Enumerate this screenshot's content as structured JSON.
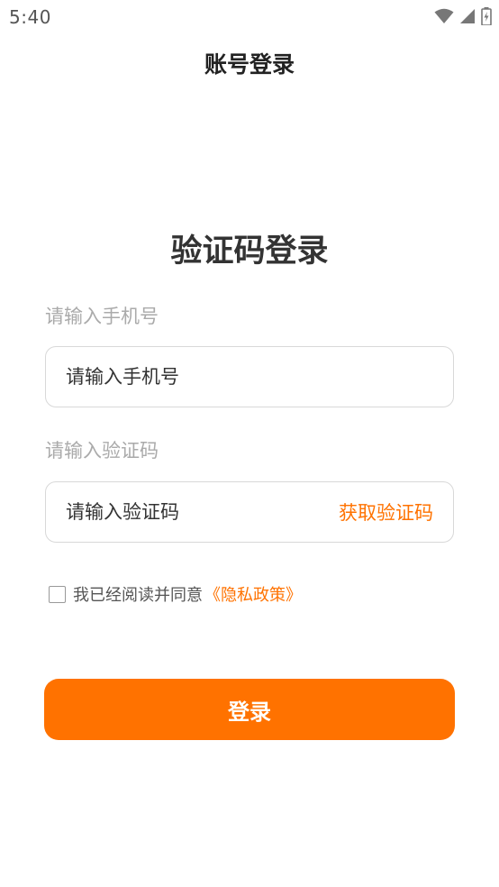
{
  "status_bar": {
    "time": "5:40",
    "icons": [
      "wifi-icon",
      "cell-signal-icon",
      "battery-icon"
    ]
  },
  "header": {
    "title": "账号登录"
  },
  "form": {
    "heading": "验证码登录",
    "phone": {
      "label": "请输入手机号",
      "placeholder": "请输入手机号",
      "value": ""
    },
    "code": {
      "label": "请输入验证码",
      "placeholder": "请输入验证码",
      "value": "",
      "get_code_label": "获取验证码"
    },
    "agreement": {
      "checked": false,
      "text": "我已经阅读并同意",
      "policy_link": "《隐私政策》"
    },
    "submit_label": "登录"
  },
  "colors": {
    "accent": "#ff7200",
    "label_gray": "#aaaaaa",
    "border": "#d8d8d8"
  }
}
